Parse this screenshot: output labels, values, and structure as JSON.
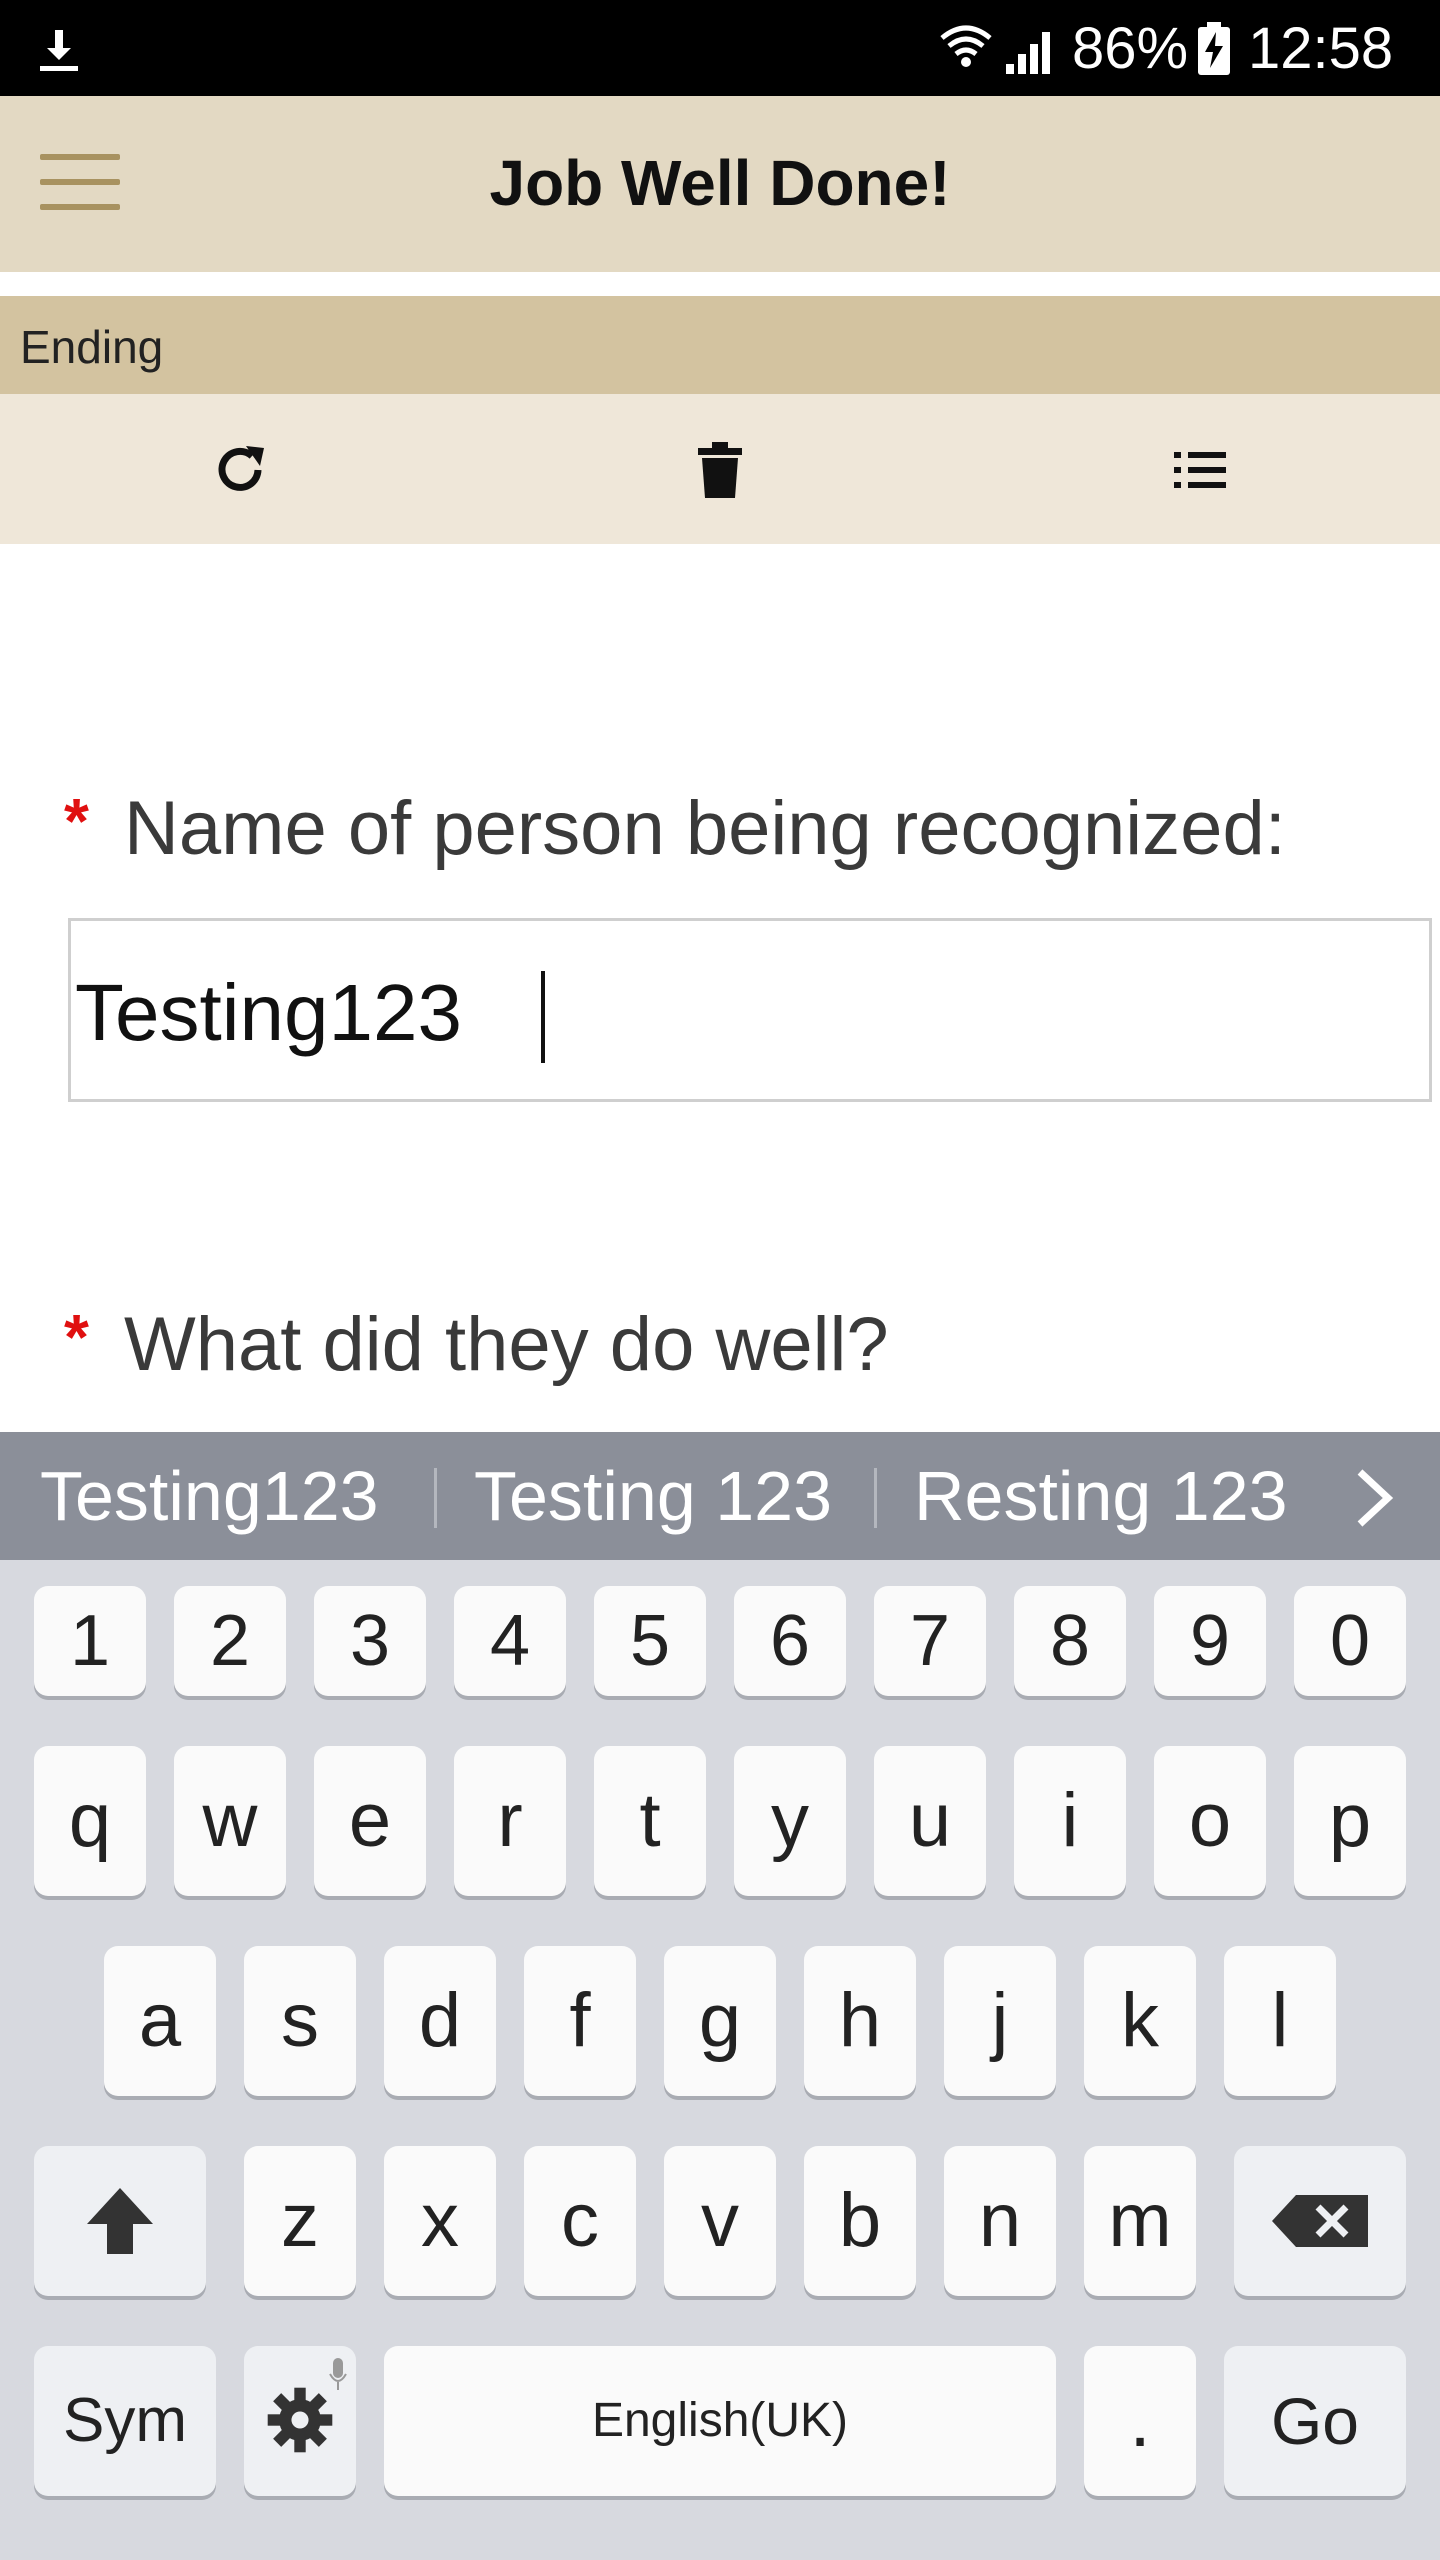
{
  "status_bar": {
    "battery_percent": "86%",
    "time": "12:58",
    "icons": [
      "download-icon",
      "wifi-icon",
      "signal-icon",
      "battery-charging-icon"
    ]
  },
  "app_bar": {
    "title": "Job Well Done!",
    "menu_icon": "hamburger-menu-icon"
  },
  "section": {
    "label": "Ending"
  },
  "toolbar": {
    "icons": [
      "refresh-icon",
      "trash-icon",
      "list-icon"
    ]
  },
  "form": {
    "required_marker": "*",
    "q1_label": "Name of person being recognized:",
    "q1_value": "Testing123",
    "q2_label": "What did they do well?"
  },
  "keyboard": {
    "suggestions": [
      "Testing123",
      "Testing 123",
      "Resting 123"
    ],
    "number_row": [
      "1",
      "2",
      "3",
      "4",
      "5",
      "6",
      "7",
      "8",
      "9",
      "0"
    ],
    "row1": [
      "q",
      "w",
      "e",
      "r",
      "t",
      "y",
      "u",
      "i",
      "o",
      "p"
    ],
    "row2": [
      "a",
      "s",
      "d",
      "f",
      "g",
      "h",
      "j",
      "k",
      "l"
    ],
    "row3": [
      "z",
      "x",
      "c",
      "v",
      "b",
      "n",
      "m"
    ],
    "sym_label": "Sym",
    "space_label": "English(UK)",
    "period_label": ".",
    "go_label": "Go"
  }
}
